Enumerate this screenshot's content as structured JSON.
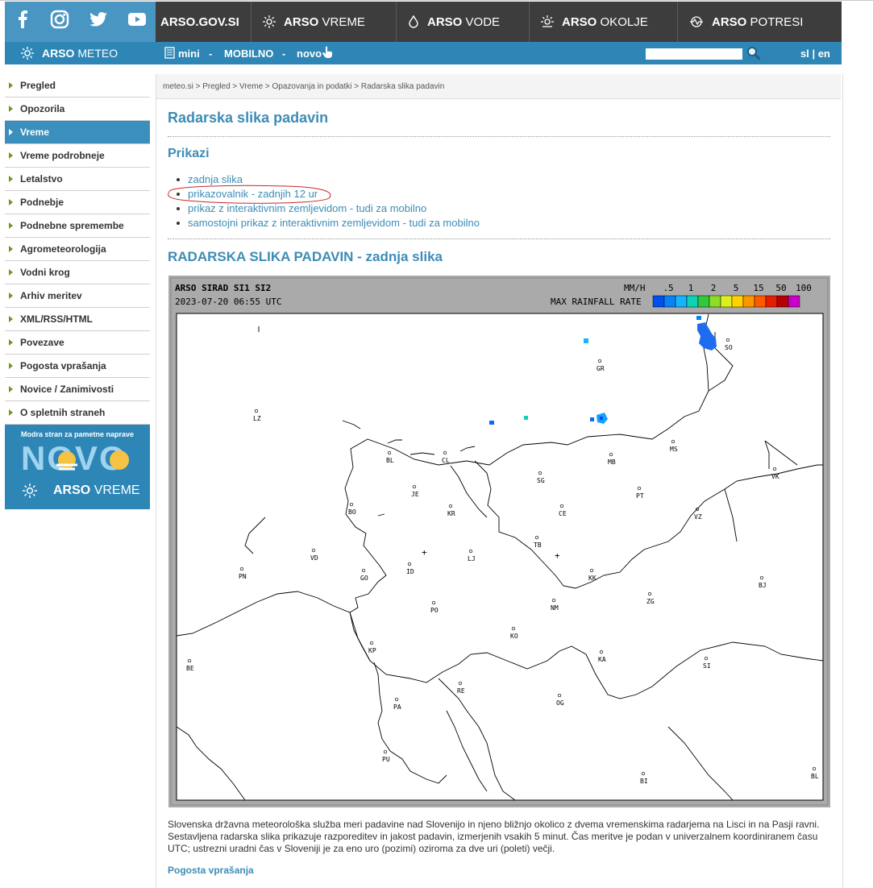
{
  "header": {
    "social_icons": [
      "facebook-icon",
      "instagram-icon",
      "twitter-icon",
      "youtube-icon"
    ],
    "meteo_label_bold": "ARSO",
    "meteo_label": "METEO",
    "nav": [
      {
        "bold": "ARSO.GOV.SI",
        "rest": ""
      },
      {
        "bold": "ARSO",
        "rest": "VREME"
      },
      {
        "bold": "ARSO",
        "rest": "VODE"
      },
      {
        "bold": "ARSO",
        "rest": "OKOLJE"
      },
      {
        "bold": "ARSO",
        "rest": "POTRESI"
      }
    ],
    "sub": {
      "mini": "mini",
      "sep": "-",
      "mobilno": "MOBILNO",
      "novo": "novo",
      "lang": "sl | en",
      "search_value": ""
    }
  },
  "sidebar": {
    "items": [
      {
        "label": "Pregled"
      },
      {
        "label": "Opozorila"
      },
      {
        "label": "Vreme"
      },
      {
        "label": "Vreme podrobneje"
      },
      {
        "label": "Letalstvo"
      },
      {
        "label": "Podnebje"
      },
      {
        "label": "Podnebne spremembe"
      },
      {
        "label": "Agrometeorologija"
      },
      {
        "label": "Vodni krog"
      },
      {
        "label": "Arhiv meritev"
      },
      {
        "label": "XML/RSS/HTML"
      },
      {
        "label": "Povezave"
      },
      {
        "label": "Pogosta vprašanja"
      },
      {
        "label": "Novice / Zanimivosti"
      },
      {
        "label": "O spletnih straneh"
      }
    ],
    "promo": {
      "tagline": "Modra stran za pametne naprave",
      "big": "NOVO",
      "brand_bold": "ARSO",
      "brand": "VREME"
    }
  },
  "main": {
    "breadcrumb": "meteo.si > Pregled > Vreme > Opazovanja in podatki > Radarska slika padavin",
    "title": "Radarska slika padavin",
    "prikazi": "Prikazi",
    "links": [
      {
        "label": "zadnja slika"
      },
      {
        "label": "prikazovalnik - zadnjih 12 ur"
      },
      {
        "label": "prikaz z interaktivnim zemljevidom - tudi za mobilno"
      },
      {
        "label": "samostojni prikaz z interaktivnim zemljevidom - tudi za mobilno"
      }
    ],
    "section_title": "RADARSKA SLIKA PADAVIN - zadnja slika",
    "radar": {
      "station": "ARSO SIRAD SI1 SI2",
      "timestamp": "2023-07-20 06:55 UTC",
      "unit": "MM/H",
      "legend_title": "MAX RAINFALL RATE",
      "scale_labels": [
        ".5",
        "1",
        "2",
        "5",
        "15",
        "50",
        "100"
      ],
      "scale_colors": [
        "#0050f0",
        "#0a82f5",
        "#14b4ff",
        "#0fd2b4",
        "#32c83c",
        "#8cdc28",
        "#dcf01e",
        "#ffd200",
        "#ff9600",
        "#ff5a00",
        "#e61e00",
        "#b40000",
        "#c800c8"
      ],
      "places": [
        "SO",
        "GR",
        "LZ",
        "MS",
        "BL",
        "CL",
        "MB",
        "SG",
        "VK",
        "JE",
        "PT",
        "BO",
        "KR",
        "CE",
        "VZ",
        "TB",
        "VD",
        "LJ",
        "ID",
        "PN",
        "GO",
        "KK",
        "BJ",
        "NM",
        "ZG",
        "PO",
        "KO",
        "KP",
        "KA",
        "SI",
        "BE",
        "RE",
        "PA",
        "OG",
        "PU",
        "BI",
        "BL"
      ]
    },
    "description": "Slovenska državna meteorološka služba meri padavine nad Slovenijo in njeno bližnjo okolico z dvema vremenskima radarjema na Lisci in na Pasji ravni. Sestavljena radarska slika prikazuje razporeditev in jakost padavin, izmerjenih vsakih 5 minut. Čas meritve je podan v univerzalnem koordiniranem času UTC; ustrezni uradni čas v Sloveniji je za eno uro (pozimi) oziroma za dve uri (poleti) večji.",
    "faq_link": "Pogosta vprašanja"
  }
}
